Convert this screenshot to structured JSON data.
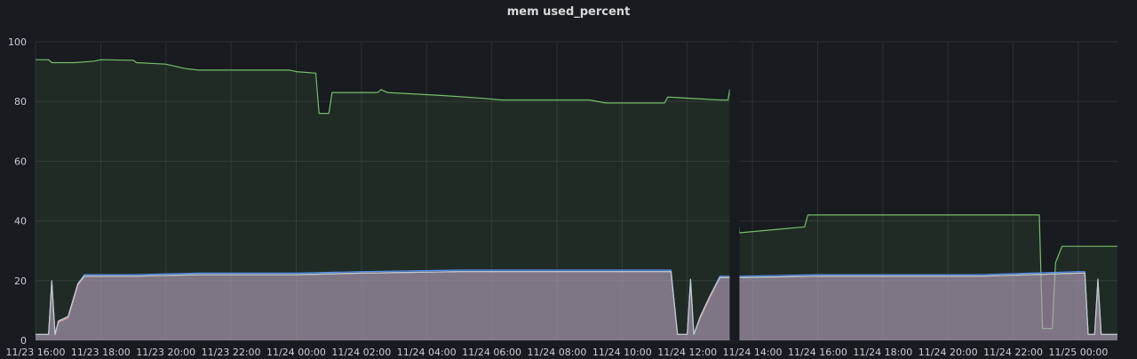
{
  "panel": {
    "title": "mem used_percent"
  },
  "chart_data": {
    "type": "area",
    "title": "mem used_percent",
    "xlabel": "",
    "ylabel": "",
    "ylim": [
      0,
      100
    ],
    "y_ticks": [
      "0",
      "20",
      "40",
      "60",
      "80",
      "100"
    ],
    "x_tick_labels": [
      "11/23 16:00",
      "11/23 18:00",
      "11/23 20:00",
      "11/23 22:00",
      "11/24 00:00",
      "11/24 02:00",
      "11/24 04:00",
      "11/24 06:00",
      "11/24 08:00",
      "11/24 10:00",
      "11/24 12:00",
      "11/24 14:00",
      "11/24 16:00",
      "11/24 18:00",
      "11/24 20:00",
      "11/24 22:00",
      "11/25 00:00"
    ],
    "x_range_hours": [
      0,
      33.2
    ],
    "grid": true,
    "legend": "none",
    "gap_hours": [
      21.3,
      21.6
    ],
    "series": [
      {
        "color": "#73bf69",
        "points": [
          [
            0,
            94
          ],
          [
            0.4,
            94
          ],
          [
            0.5,
            93
          ],
          [
            1.2,
            93
          ],
          [
            1.8,
            93.5
          ],
          [
            2,
            94
          ],
          [
            3,
            93.8
          ],
          [
            3.1,
            93
          ],
          [
            4,
            92.5
          ],
          [
            4.6,
            91
          ],
          [
            5,
            90.5
          ],
          [
            7.8,
            90.5
          ],
          [
            8,
            90
          ],
          [
            8.6,
            89.5
          ],
          [
            8.7,
            76
          ],
          [
            9,
            76
          ],
          [
            9.1,
            83
          ],
          [
            10.5,
            83
          ],
          [
            10.6,
            84
          ],
          [
            10.8,
            83
          ],
          [
            12.5,
            82
          ],
          [
            13.8,
            81
          ],
          [
            14.3,
            80.5
          ],
          [
            17,
            80.5
          ],
          [
            17.5,
            79.5
          ],
          [
            19.3,
            79.5
          ],
          [
            19.4,
            81.5
          ],
          [
            21,
            80.5
          ],
          [
            21.25,
            80.5
          ],
          [
            21.3,
            84
          ],
          [
            21.6,
            36
          ],
          [
            23.6,
            38
          ],
          [
            23.7,
            42
          ],
          [
            30.8,
            42
          ],
          [
            30.9,
            4
          ],
          [
            31.2,
            4
          ],
          [
            31.3,
            26
          ],
          [
            31.5,
            31.5
          ],
          [
            33.2,
            31.5
          ]
        ]
      },
      {
        "color": "#5794f2",
        "points": [
          [
            0,
            2
          ],
          [
            0.4,
            2
          ],
          [
            0.5,
            19.5
          ],
          [
            0.6,
            2
          ],
          [
            0.7,
            6
          ],
          [
            1,
            8
          ],
          [
            1.3,
            19
          ],
          [
            1.5,
            22
          ],
          [
            3,
            22
          ],
          [
            5,
            22.5
          ],
          [
            8,
            22.5
          ],
          [
            10,
            23
          ],
          [
            13,
            23.5
          ],
          [
            19.5,
            23.5
          ],
          [
            19.7,
            2
          ],
          [
            20,
            2
          ],
          [
            20.1,
            20
          ],
          [
            20.2,
            2
          ],
          [
            20.4,
            8
          ],
          [
            20.7,
            15
          ],
          [
            21,
            21.5
          ],
          [
            21.3,
            21.5
          ],
          [
            21.6,
            21.5
          ],
          [
            24,
            22
          ],
          [
            29,
            22
          ],
          [
            32,
            23
          ],
          [
            32.2,
            23
          ],
          [
            32.3,
            2
          ],
          [
            32.5,
            2
          ],
          [
            32.6,
            20
          ],
          [
            32.7,
            2
          ],
          [
            33.2,
            2
          ]
        ]
      },
      {
        "color": "#ff7383",
        "points": [
          [
            0,
            2
          ],
          [
            0.4,
            2
          ],
          [
            0.5,
            19
          ],
          [
            0.6,
            2
          ],
          [
            0.7,
            6
          ],
          [
            1,
            7.5
          ],
          [
            1.3,
            18.5
          ],
          [
            1.5,
            21.5
          ],
          [
            3,
            21.5
          ],
          [
            5,
            22
          ],
          [
            8,
            22
          ],
          [
            10,
            22.5
          ],
          [
            13,
            23
          ],
          [
            19.5,
            23
          ],
          [
            19.7,
            2
          ],
          [
            20,
            2
          ],
          [
            20.1,
            19.5
          ],
          [
            20.2,
            2
          ],
          [
            20.4,
            7.5
          ],
          [
            20.7,
            14.5
          ],
          [
            21,
            21
          ],
          [
            21.3,
            21
          ],
          [
            21.6,
            21
          ],
          [
            24,
            21.5
          ],
          [
            29,
            21.5
          ],
          [
            32,
            22.5
          ],
          [
            32.2,
            22.5
          ],
          [
            32.3,
            2
          ],
          [
            32.5,
            2
          ],
          [
            32.6,
            19.5
          ],
          [
            32.7,
            2
          ],
          [
            33.2,
            2
          ]
        ]
      },
      {
        "color": "#b8cfd2",
        "points": [
          [
            0,
            2
          ],
          [
            0.4,
            2
          ],
          [
            0.5,
            20
          ],
          [
            0.6,
            2
          ],
          [
            0.7,
            6.5
          ],
          [
            1,
            8
          ],
          [
            1.3,
            19
          ],
          [
            1.5,
            21.5
          ],
          [
            3,
            21.5
          ],
          [
            5,
            22
          ],
          [
            8,
            22
          ],
          [
            10,
            22.5
          ],
          [
            13,
            23
          ],
          [
            19.5,
            23
          ],
          [
            19.7,
            2
          ],
          [
            20,
            2
          ],
          [
            20.1,
            20.5
          ],
          [
            20.2,
            2
          ],
          [
            20.4,
            8
          ],
          [
            20.7,
            15
          ],
          [
            21,
            21
          ],
          [
            21.3,
            21
          ],
          [
            21.6,
            21
          ],
          [
            24,
            21.5
          ],
          [
            29,
            21.5
          ],
          [
            32,
            22.5
          ],
          [
            32.2,
            22.5
          ],
          [
            32.3,
            2
          ],
          [
            32.5,
            2
          ],
          [
            32.6,
            20.5
          ],
          [
            32.7,
            2
          ],
          [
            33.2,
            2
          ]
        ]
      }
    ]
  }
}
